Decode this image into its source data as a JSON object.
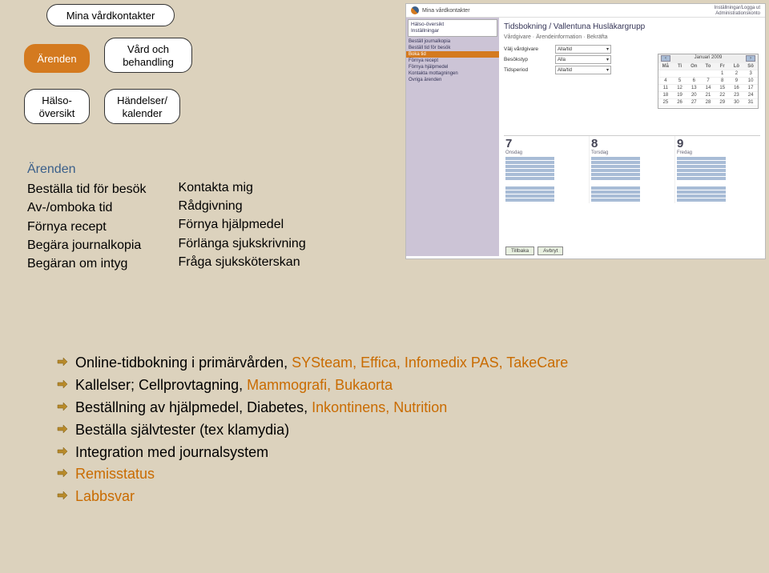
{
  "sitemap": {
    "root": "Mina vårdkontakter",
    "n1": "Ärenden",
    "n2": "Vård och behandling",
    "n3": "Hälso-\növersikt",
    "n4": "Händelser/\nkalender"
  },
  "menus": {
    "title": "Ärenden",
    "left": [
      "Beställa tid för besök",
      "Av-/omboka tid",
      "Förnya recept",
      "Begära journalkopia",
      "Begäran om intyg"
    ],
    "right": [
      "Kontakta mig",
      "Rådgivning",
      "Förnya hjälpmedel",
      "Förlänga sjukskrivning",
      "Fråga sjuksköterskan"
    ]
  },
  "bullets": [
    {
      "segments": [
        {
          "t": "Online-tidbokning i primärvården, ",
          "c": "black"
        },
        {
          "t": "SYSteam, Effica, Infomedix PAS, TakeCare",
          "c": "orange"
        }
      ]
    },
    {
      "segments": [
        {
          "t": "Kallelser; Cellprovtagning, ",
          "c": "black"
        },
        {
          "t": "Mammografi, Bukaorta",
          "c": "orange"
        }
      ]
    },
    {
      "segments": [
        {
          "t": "Beställning av hjälpmedel, Diabetes,  ",
          "c": "black"
        },
        {
          "t": "Inkontinens, Nutrition",
          "c": "orange"
        }
      ]
    },
    {
      "segments": [
        {
          "t": "Beställa självtester (tex klamydia)",
          "c": "black"
        }
      ]
    },
    {
      "segments": [
        {
          "t": "Integration med journalsystem",
          "c": "black"
        }
      ]
    },
    {
      "segments": [
        {
          "t": "Remisstatus",
          "c": "orange"
        }
      ]
    },
    {
      "segments": [
        {
          "t": "Labbsvar",
          "c": "orange"
        }
      ]
    }
  ],
  "shot": {
    "brand": "Mina vårdkontakter",
    "title": "Tidsbokning / Vallentuna Husläkargrupp",
    "select_label_org": "Välj vårdgivare",
    "select_value_org": "Alla/tid",
    "select_label_type": "Besökstyp",
    "select_value_type": "Alla",
    "select_label_time": "Tidsperiod",
    "select_value_time": "Alla/tid",
    "cal_month": "Januari 2009",
    "days": [
      "Må",
      "Ti",
      "On",
      "To",
      "Fr",
      "Lö",
      "Sö"
    ],
    "day1_num": "7",
    "day1_name": "Onsdag",
    "day2_num": "8",
    "day2_name": "Torsdag",
    "day3_num": "9",
    "day3_name": "Fredag",
    "btn_back": "Tillbaka",
    "btn_cancel": "Avbryt"
  }
}
